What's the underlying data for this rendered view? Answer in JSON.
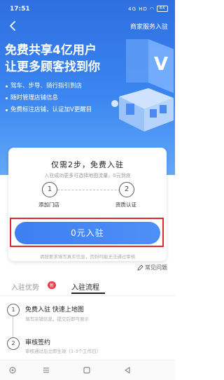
{
  "status_bar": {
    "time": "17:51",
    "indicators": "4G HD",
    "battery": "84"
  },
  "nav": {
    "back_icon": "back-chevron-icon",
    "right_link": "商家服务入驻"
  },
  "hero": {
    "headline_line1": "免费共享4亿用户",
    "headline_line2": "让更多顾客找到你",
    "bullets": [
      "驾车、步导、骑行指引到店",
      "随时管理店铺信息",
      "免费标注店铺，认证加V更醒目"
    ],
    "illustration": "storefront-map-illustration"
  },
  "card": {
    "title": "仅需2步，免费入驻",
    "subtitle": "入驻成功更多可选择地图流量，0元到底",
    "steps": [
      {
        "number": "1",
        "label": "添加门店"
      },
      {
        "number": "2",
        "label": "资质认证"
      }
    ],
    "cta_label": "0元入驻",
    "disclaimer": "请按要求填写真实信息，否则可能无法通过审核"
  },
  "faq_label": "常见问题",
  "tabs": [
    {
      "label": "入驻优势",
      "badge": "新"
    },
    {
      "label": "入驻流程"
    }
  ],
  "timeline": [
    {
      "number": "1",
      "title": "免费入驻 快速上地图",
      "subtitle": "填写店铺信息，提交后即可展示"
    },
    {
      "number": "2",
      "title": "审核签约",
      "subtitle": "审核通过后立即生效（1-3个工作日）"
    }
  ],
  "colors": {
    "hero_blue": "#3a86f0",
    "cta_blue": "#4282f3",
    "highlight_red": "#e0262e",
    "badge_red": "#e8404a"
  }
}
